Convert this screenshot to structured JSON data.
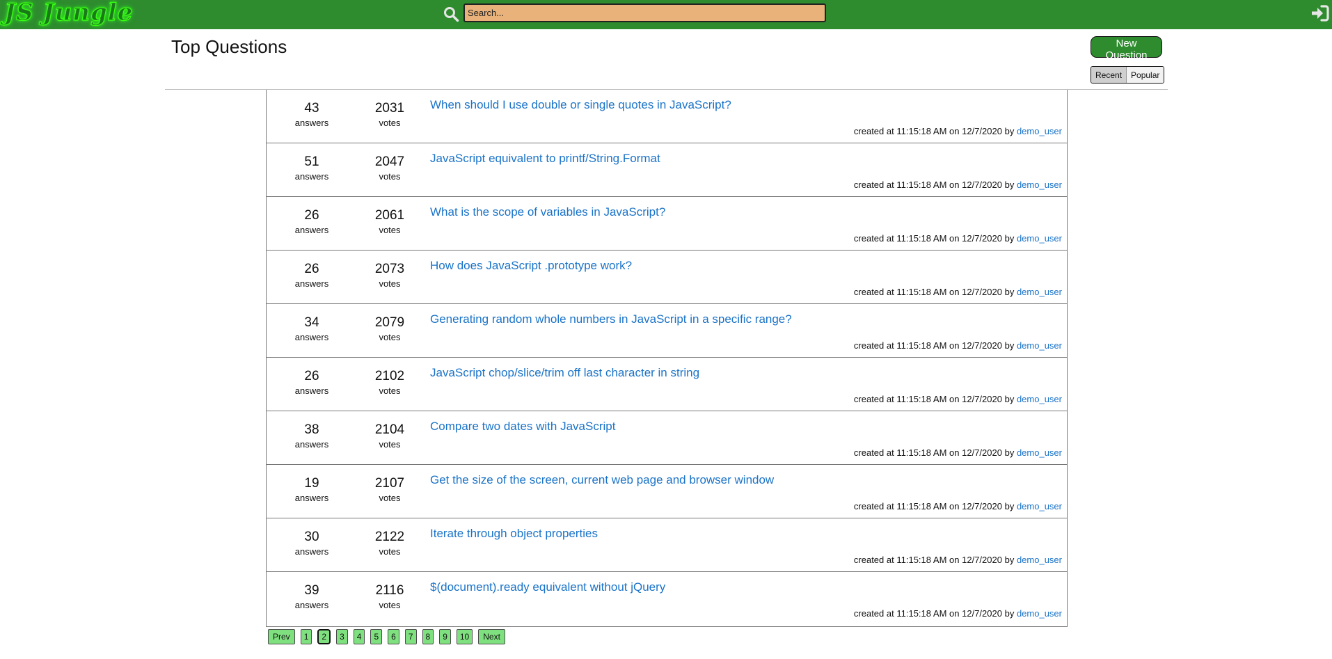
{
  "app": {
    "logo": "JS Jungle",
    "search_placeholder": "Search..."
  },
  "header": {
    "title": "Top Questions",
    "new_question_label": "New Question",
    "sort_options": [
      "Recent",
      "Popular"
    ],
    "active_sort": "Recent"
  },
  "questions": [
    {
      "answers": "43",
      "votes": "2031",
      "title": "When should I use double or single quotes in JavaScript?",
      "time": "11:15:18 AM",
      "date": "12/7/2020",
      "user": "demo_user"
    },
    {
      "answers": "51",
      "votes": "2047",
      "title": "JavaScript equivalent to printf/String.Format",
      "time": "11:15:18 AM",
      "date": "12/7/2020",
      "user": "demo_user"
    },
    {
      "answers": "26",
      "votes": "2061",
      "title": "What is the scope of variables in JavaScript?",
      "time": "11:15:18 AM",
      "date": "12/7/2020",
      "user": "demo_user"
    },
    {
      "answers": "26",
      "votes": "2073",
      "title": "How does JavaScript .prototype work?",
      "time": "11:15:18 AM",
      "date": "12/7/2020",
      "user": "demo_user"
    },
    {
      "answers": "34",
      "votes": "2079",
      "title": "Generating random whole numbers in JavaScript in a specific range?",
      "time": "11:15:18 AM",
      "date": "12/7/2020",
      "user": "demo_user"
    },
    {
      "answers": "26",
      "votes": "2102",
      "title": "JavaScript chop/slice/trim off last character in string",
      "time": "11:15:18 AM",
      "date": "12/7/2020",
      "user": "demo_user"
    },
    {
      "answers": "38",
      "votes": "2104",
      "title": "Compare two dates with JavaScript",
      "time": "11:15:18 AM",
      "date": "12/7/2020",
      "user": "demo_user"
    },
    {
      "answers": "19",
      "votes": "2107",
      "title": "Get the size of the screen, current web page and browser window",
      "time": "11:15:18 AM",
      "date": "12/7/2020",
      "user": "demo_user"
    },
    {
      "answers": "30",
      "votes": "2122",
      "title": "Iterate through object properties",
      "time": "11:15:18 AM",
      "date": "12/7/2020",
      "user": "demo_user"
    },
    {
      "answers": "39",
      "votes": "2116",
      "title": "$(document).ready equivalent without jQuery",
      "time": "11:15:18 AM",
      "date": "12/7/2020",
      "user": "demo_user"
    }
  ],
  "labels": {
    "answers": "answers",
    "votes": "votes",
    "created_at": "created at",
    "on": "on",
    "by": "by"
  },
  "pagination": {
    "prev_label": "Prev",
    "next_label": "Next",
    "pages": [
      "1",
      "2",
      "3",
      "4",
      "5",
      "6",
      "7",
      "8",
      "9",
      "10"
    ],
    "current": "2"
  },
  "colors": {
    "topbar": "#2e8b2e",
    "search_bg": "#e8b27a",
    "link": "#1a73c8",
    "pager_bg": "#7fe07f"
  },
  "icons": {
    "search": "search-icon",
    "login": "sign-in-icon"
  }
}
